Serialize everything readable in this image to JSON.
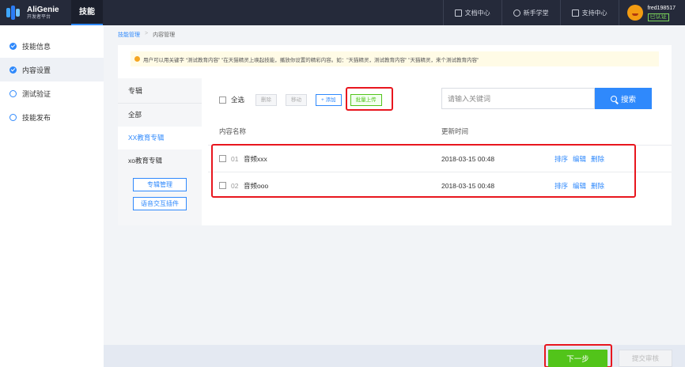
{
  "header": {
    "brand_name": "AliGenie",
    "brand_sub": "开发者平台",
    "active_tab": "技能",
    "links": [
      "文档中心",
      "新手学堂",
      "支持中心"
    ],
    "username": "fred198517",
    "verified": "已认证"
  },
  "sidebar": {
    "items": [
      {
        "label": "技能信息",
        "state": "done"
      },
      {
        "label": "内容设置",
        "state": "done"
      },
      {
        "label": "测试验证",
        "state": "todo"
      },
      {
        "label": "技能发布",
        "state": "todo"
      }
    ]
  },
  "breadcrumb": {
    "parent": "技能管理",
    "separator": ">",
    "current": "内容管理"
  },
  "notice": "用户可以用关键字 “测试教育内容” \"在天猫精灵上唤起技能，播放你设置的精彩内容。如：\"天猫精灵，测试教育内容\" \"天猫精灵，来个测试教育内容\"",
  "albums": {
    "header": "专辑",
    "items": [
      "全部",
      "XX教育专辑",
      "xo教育专辑"
    ],
    "active_index": 1,
    "manage_button": "专辑管理",
    "plugin_button": "语音交互插件"
  },
  "toolbar": {
    "select_all": "全选",
    "delete": "删除",
    "move": "移动",
    "add": "+ 添加",
    "batch_upload": "批量上传"
  },
  "search": {
    "placeholder": "请输入关键词",
    "button": "搜索"
  },
  "table": {
    "headers": [
      "内容名称",
      "更新时间"
    ],
    "rows": [
      {
        "index": "01",
        "name": "音频xxx",
        "time": "2018-03-15 00:48",
        "actions": [
          "排序",
          "编辑",
          "删除"
        ]
      },
      {
        "index": "02",
        "name": "音频ooo",
        "time": "2018-03-15 00:48",
        "actions": [
          "排序",
          "编辑",
          "删除"
        ]
      }
    ]
  },
  "footer": {
    "next": "下一步",
    "submit": "提交审核"
  },
  "colors": {
    "primary": "#2f89fc",
    "success": "#52c41a",
    "highlight": "#e8161e",
    "topbar": "#252a3a"
  }
}
